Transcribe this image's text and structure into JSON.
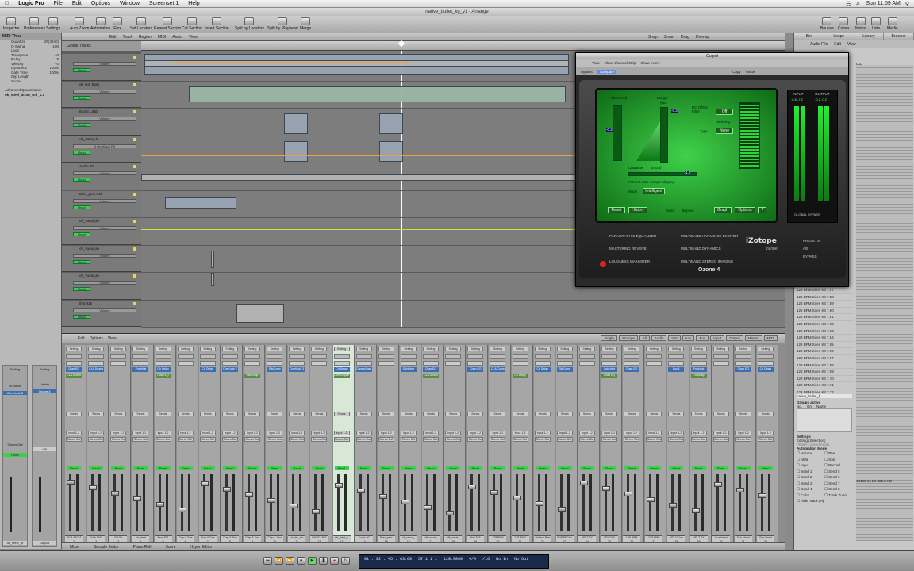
{
  "menubar": {
    "app": "Logic Pro",
    "items": [
      "File",
      "Edit",
      "Options",
      "Window",
      "Screenset 1",
      "Help"
    ],
    "clock": "Sun 11:59 AM"
  },
  "window": {
    "title": "native_bullet_kg_v1 - Arrange"
  },
  "toolbar": {
    "left": [
      "Inspector",
      "Preferences",
      "Settings"
    ],
    "center": [
      "Auto Zoom",
      "Automation",
      "Flex",
      "Set Locators",
      "Repeat Section",
      "Cut Section",
      "Insert Section",
      "Split by Locators",
      "Split by Playhead",
      "Merge"
    ],
    "right": [
      "Bounce",
      "Colors",
      "Notes",
      "Lists",
      "Media"
    ]
  },
  "inspector": {
    "header": "MIDI Thru",
    "rows": [
      {
        "k": "Quantize",
        "v": "off (3840)"
      },
      {
        "k": "Q-Swing",
        "v": "+100"
      },
      {
        "k": "Loop",
        "v": ""
      },
      {
        "k": "Transpose",
        "v": "+0"
      },
      {
        "k": "Delay",
        "v": "0"
      },
      {
        "k": "Velocity",
        "v": "+0"
      },
      {
        "k": "Dynamics",
        "v": "100%"
      },
      {
        "k": "Gate Time",
        "v": "100%"
      },
      {
        "k": "Clip Length",
        "v": ""
      },
      {
        "k": "Score",
        "v": ""
      }
    ],
    "adv": "Advanced Quantization",
    "region": "ok_steel_drum_roll_1.1",
    "bottom_labels": [
      "Setting",
      "Setting",
      "Sends",
      "Hi-Strike",
      "OneKnob 3",
      "Limiter",
      "Ozone 4",
      "Send",
      "Stereo Out"
    ],
    "auto_1": "Read",
    "auto_2": "Off",
    "name_1": "ok_steel_dr",
    "name_2": "Output"
  },
  "arrange": {
    "menus": [
      "Edit",
      "Track",
      "Region",
      "MIDI",
      "Audio",
      "View"
    ],
    "right_menus": [
      "Snap",
      "Smart",
      "Drag",
      "Overlap"
    ],
    "folder": "Global Tracks",
    "volume_label": "Volume",
    "read_label": "Read",
    "tracks": [
      {
        "name": "",
        "auto": "Volume"
      },
      {
        "name": "ok_fx4_bass",
        "auto": "Volume"
      },
      {
        "name": "BASS LINE",
        "auto": "Volume"
      },
      {
        "name": "ok_steel_dr",
        "auto": "4 OneKnob FX"
      },
      {
        "name": "Audio 20",
        "auto": "Volume"
      },
      {
        "name": "80er_perc KM",
        "auto": "Volume"
      },
      {
        "name": "off_vocal_ilo",
        "auto": "Volume"
      },
      {
        "name": "off_vocal_ilo",
        "auto": "Volume"
      },
      {
        "name": "off_vocal_ilo",
        "auto": "Volume"
      },
      {
        "name": "thin 815",
        "auto": "Volume"
      }
    ]
  },
  "mixer": {
    "menus": [
      "Edit",
      "Options",
      "View"
    ],
    "tabs": [
      "Single",
      "Arrange",
      "All",
      "Audio",
      "Inst",
      "Aux",
      "Bus",
      "Input",
      "Output",
      "Master",
      "MIDI"
    ],
    "strips": [
      {
        "name": "SKR 4BCM",
        "num": "1"
      },
      {
        "name": "Kick 806",
        "num": "2"
      },
      {
        "name": "GB Sn",
        "num": "3"
      },
      {
        "name": "nb_steel",
        "num": "4"
      },
      {
        "name": "Perc 831",
        "num": "5"
      },
      {
        "name": "Clap & Sna",
        "num": "6"
      },
      {
        "name": "Clap & Sna",
        "num": "7"
      },
      {
        "name": "Clap & Sna",
        "num": "8"
      },
      {
        "name": "Clap & Sna",
        "num": "9"
      },
      {
        "name": "Clap & Sna",
        "num": "10"
      },
      {
        "name": "ok_fx4_ba",
        "num": "11"
      },
      {
        "name": "BASS LINE",
        "num": "12"
      },
      {
        "name": "nb_steel_d",
        "num": "13"
      },
      {
        "name": "Audio 20",
        "num": "14"
      },
      {
        "name": "80er_perc",
        "num": "15"
      },
      {
        "name": "off_vocal_",
        "num": "16"
      },
      {
        "name": "off_vocal_",
        "num": "17"
      },
      {
        "name": "off_vocal_",
        "num": "18"
      },
      {
        "name": "thin 815",
        "num": "19"
      },
      {
        "name": "128 BPM",
        "num": "20"
      },
      {
        "name": "128 BPM",
        "num": "21"
      },
      {
        "name": "Ableton Rse",
        "num": "22"
      },
      {
        "name": "EVP88 Clsc",
        "num": "23"
      },
      {
        "name": "VEL2 FX",
        "num": "24"
      },
      {
        "name": "VEL2 FX",
        "num": "25"
      },
      {
        "name": "128 BPM",
        "num": "26"
      },
      {
        "name": "128 BPM",
        "num": "27"
      },
      {
        "name": "VEL2 Clap",
        "num": "28"
      },
      {
        "name": "VEL2 FX",
        "num": "29"
      },
      {
        "name": "Gun Hand",
        "num": "30"
      },
      {
        "name": "Gun Hand",
        "num": "31"
      },
      {
        "name": "Gun Hand",
        "num": "32"
      }
    ],
    "setting_label": "Setting",
    "sends_label": "Sends",
    "io_in": "Input 1-2",
    "io_out": "Stereo Out",
    "auto": "Read",
    "plugins": [
      "Chan EQ",
      "CLA Drums",
      "Bus 1",
      "PunkHat",
      "Ch Delay",
      "Chan EQ",
      "Ch Delay",
      "OneKnob E",
      "CLA Bass",
      "SilvComp",
      "OneKnob 3",
      "OneKnob E",
      "Ch Delay",
      "CompuSpac",
      "SilvComp",
      "GoldVerb",
      "Chan EQ",
      "CLA Drums",
      "Chan EQ",
      "CLA Comp",
      "Chan EQ",
      "Ch Delay",
      "SilvComp",
      "GoldVerb",
      "GoldVerb"
    ]
  },
  "bottombar": [
    "Mixer",
    "Sample Editor",
    "Piano Roll",
    "Score",
    "Hyper Editor"
  ],
  "transport": {
    "position": "01 : 02 : 45 : 03.60",
    "bars": "57  1  1  1",
    "tempo": "128.0000",
    "sig": "4/4",
    "div": "/16",
    "in": "No In",
    "out": "No Out"
  },
  "browser": {
    "tabs": [
      "Bin",
      "Loops",
      "Library",
      "Browser"
    ],
    "menus": [
      "Audio File",
      "Edit",
      "View"
    ],
    "info": "Info",
    "files": [
      "128 BPM Siren Kit 7.57",
      "128 BPM Siren Kit 7.58",
      "128 BPM Siren Kit 7.59",
      "128 BPM Siren Kit 7.60",
      "128 BPM Siren Kit 7.61",
      "128 BPM Siren Kit 7.62",
      "128 BPM Siren Kit 7.63",
      "128 BPM Siren Kit 7.64",
      "128 BPM Siren Kit 7.65",
      "128 BPM Siren Kit 7.66",
      "128 BPM Siren Kit 7.67",
      "128 BPM Siren Kit 7.68",
      "128 BPM Siren Kit 7.69",
      "128 BPM Siren Kit 7.70",
      "128 BPM Siren Kit 7.71",
      "128 BPM Siren Kit 7.72"
    ],
    "sel_file": "native_bullet_k",
    "groups_active": "Groups active",
    "col_no": "No.",
    "col_on": "On",
    "col_name": "Name",
    "settings": "Settings",
    "editing": "Editing (Selection)",
    "phase": "Phase-Locked Audio",
    "automode": "Automation Mode",
    "checks": [
      "Volume",
      "Pan",
      "Mute",
      "Solo",
      "Input",
      "Record",
      "Send 1",
      "Send 5",
      "Send 2",
      "Send 6",
      "Send 3",
      "Send 7",
      "Send 4",
      "Send 8",
      "Color",
      "Track Zoom",
      "Hide Track (H)"
    ],
    "info_line": "44100  16 Bit  325.8 KB"
  },
  "ozone": {
    "title": "Output",
    "menus": [
      "View",
      "Show Channel Strip",
      "Show Insert"
    ],
    "bypass": "Bypass",
    "compare": "Compare",
    "copy": "Copy",
    "paste": "Paste",
    "threshold": "Threshold",
    "margin": "Margin",
    "margin_unit": "(dB)",
    "threshold_val": "-0.2",
    "margin_val": "-0.3",
    "dc_offset": "DC Offset Filter",
    "off": "Off",
    "dithering": "Dithering",
    "type": "Type",
    "none": "None",
    "character": "Character",
    "smooth": "smooth",
    "character_val": "4.0",
    "prevent": "Prevent inter-sample clipping",
    "mode": "Mode",
    "intelligent": "Intelligent",
    "buttons": [
      "Reset",
      "History",
      "Solo",
      "Bypass",
      "Graph",
      "Options",
      "?"
    ],
    "modules": [
      "PARAGRAPHIC EQUALIZER",
      "MULTIBAND HARMONIC EXCITER",
      "MASTERING REVERB",
      "MULTIBAND DYNAMICS",
      "LOUDNESS MAXIMIZER",
      "MULTIBAND STEREO IMAGING"
    ],
    "input": "INPUT",
    "output": "OUTPUT",
    "global_bypass": "GLOBAL BYPASS",
    "presets": "PRESETS",
    "ab": "A/B",
    "bypass_btn": "BYPASS",
    "brand": "iZotope",
    "product": "ozone",
    "name": "Ozone 4",
    "in_vals": "-6.6  -7.2",
    "out_vals": "-0.2  -0.2"
  },
  "colors": {
    "read_green": "#3fcf4f",
    "ozone_screen": "#2fbf3a",
    "playhead": "#ffffff"
  }
}
